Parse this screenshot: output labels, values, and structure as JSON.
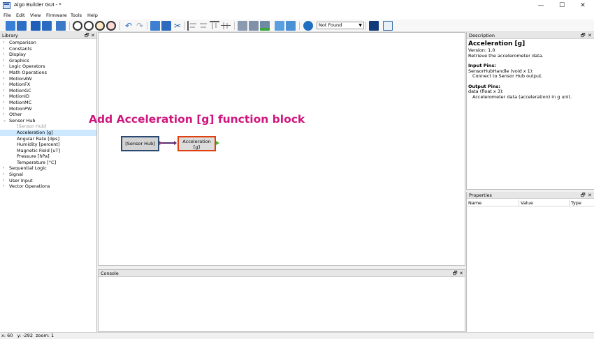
{
  "window": {
    "title": "Algo Builder GUI - *"
  },
  "menu": [
    "File",
    "Edit",
    "View",
    "Firmware",
    "Tools",
    "Help"
  ],
  "toolbar": {
    "firmware_select": "Not Found",
    "icons": [
      "new-file-icon",
      "open-file-icon",
      "save-icon",
      "save-as-icon",
      "settings-wrench-icon",
      "zoom-in-icon",
      "zoom-out-icon",
      "zoom-reset-icon",
      "zoom-fit-icon",
      "undo-icon",
      "redo-icon",
      "copy-icon",
      "paste-icon",
      "cut-icon",
      "align-left-icon",
      "align-center-icon",
      "align-top-icon",
      "align-middle-icon",
      "generate-code-icon",
      "build-icon",
      "program-icon",
      "file-icon-a",
      "file-icon-b",
      "upload-icon",
      "board-icon",
      "monitor-icon"
    ]
  },
  "library": {
    "title": "Library",
    "items": [
      {
        "label": "Comparison",
        "arrow": ">"
      },
      {
        "label": "Constants",
        "arrow": ">"
      },
      {
        "label": "Display",
        "arrow": ">"
      },
      {
        "label": "Graphics",
        "arrow": ">"
      },
      {
        "label": "Logic Operators",
        "arrow": ">"
      },
      {
        "label": "Math Operations",
        "arrow": ">"
      },
      {
        "label": "MotionAW",
        "arrow": ">"
      },
      {
        "label": "MotionFX",
        "arrow": ">"
      },
      {
        "label": "MotionGC",
        "arrow": ">"
      },
      {
        "label": "MotionID",
        "arrow": ">"
      },
      {
        "label": "MotionMC",
        "arrow": ">"
      },
      {
        "label": "MotionPW",
        "arrow": ">"
      },
      {
        "label": "Other",
        "arrow": ">"
      },
      {
        "label": "Sensor Hub",
        "arrow": "v"
      },
      {
        "label": "[Sensor Hub]",
        "child": true,
        "disabled": true
      },
      {
        "label": "Acceleration [g]",
        "child": true,
        "selected": true
      },
      {
        "label": "Angular Rate [dps]",
        "child": true
      },
      {
        "label": "Humidity [percent]",
        "child": true
      },
      {
        "label": "Magnetic Field [uT]",
        "child": true
      },
      {
        "label": "Pressure [hPa]",
        "child": true
      },
      {
        "label": "Temperature [°C]",
        "child": true
      },
      {
        "label": "Sequential Logic",
        "arrow": ">"
      },
      {
        "label": "Signal",
        "arrow": ">"
      },
      {
        "label": "User Input",
        "arrow": ">"
      },
      {
        "label": "Vector Operations",
        "arrow": ">"
      }
    ]
  },
  "canvas": {
    "caption": "Add Acceleration [g] function block",
    "sensor_hub_block": "[Sensor Hub]",
    "accel_block_line1": "Acceleration",
    "accel_block_line2": "[g]"
  },
  "console": {
    "title": "Console"
  },
  "description": {
    "panel_title": "Description",
    "title": "Acceleration [g]",
    "version": "Version: 1.0",
    "summary": "Retrieve the accelerometer data.",
    "input_pins_label": "Input Pins:",
    "input_pin": "SensorHubHandle (void x 1):",
    "input_pin_desc": "Connect to Sensor Hub output.",
    "output_pins_label": "Output Pins:",
    "output_pin": "data (float x 3):",
    "output_pin_desc": "Accelerometer data (acceleration) in g unit."
  },
  "properties": {
    "title": "Properties",
    "columns": [
      "Name",
      "Value",
      "Type"
    ]
  },
  "panel_controls": {
    "float": "🗗",
    "close": "✕"
  },
  "status": "x: 60   y: -292  zoom: 1"
}
